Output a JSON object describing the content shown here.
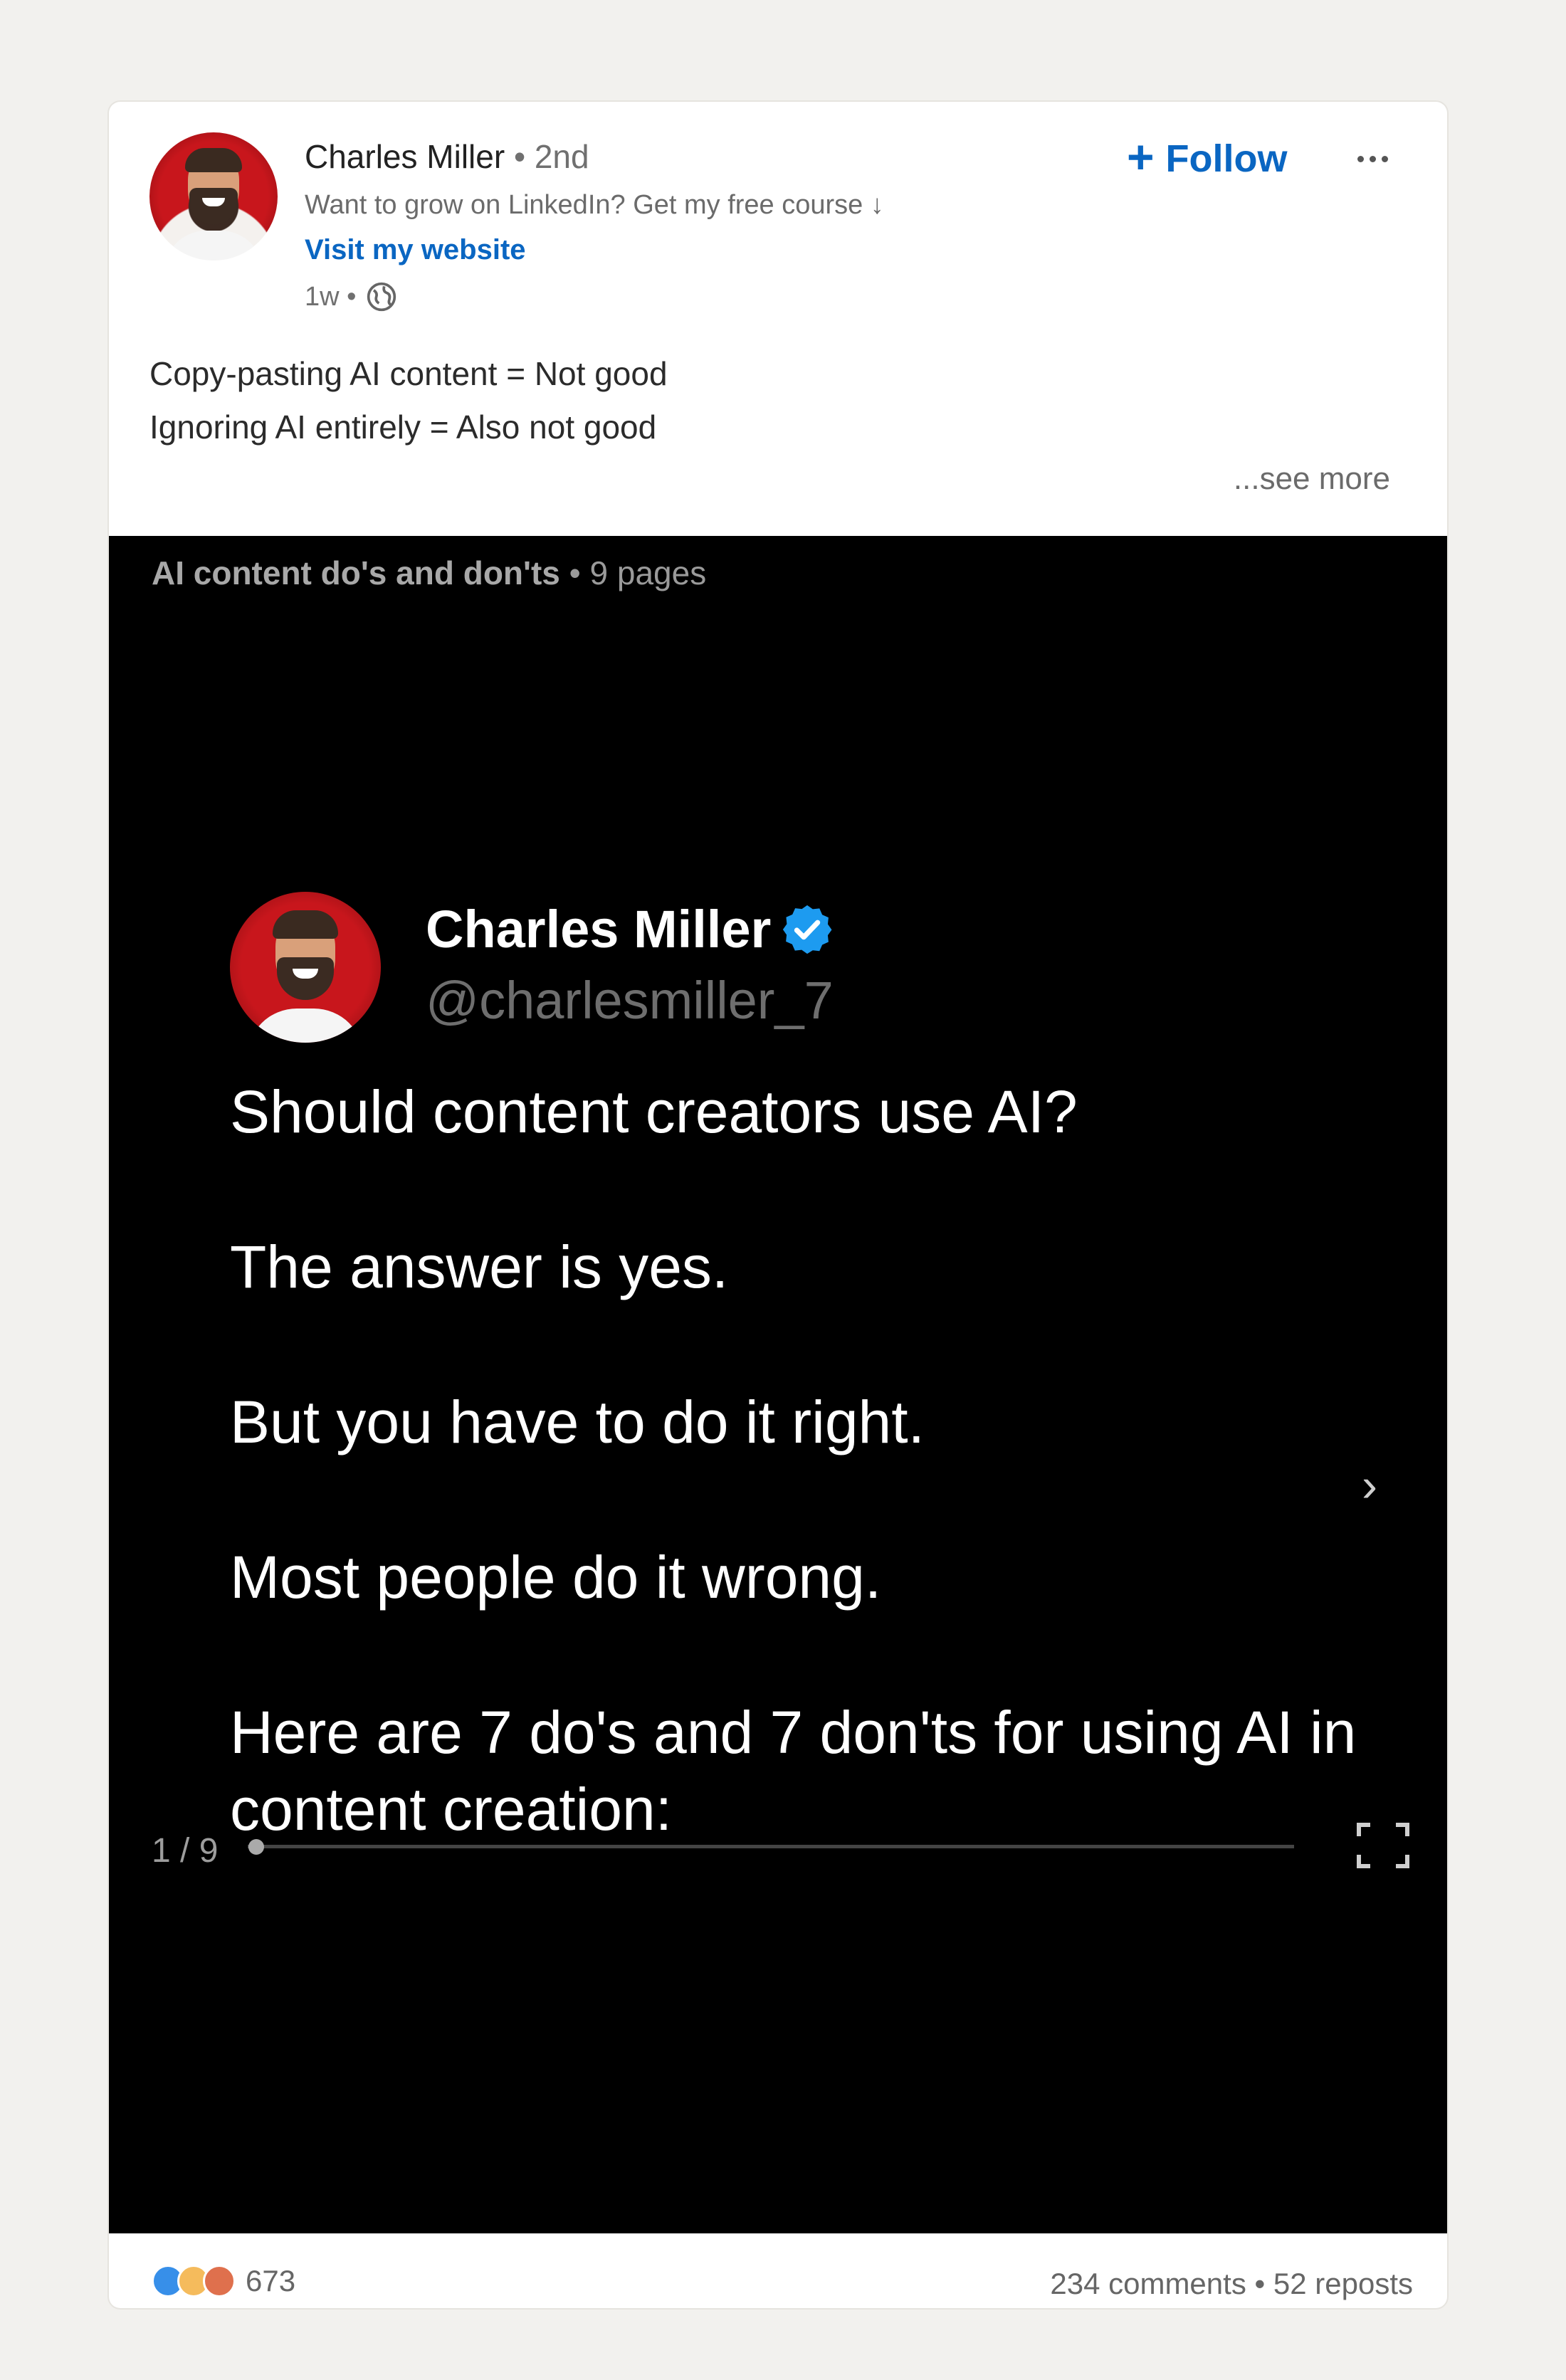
{
  "author": {
    "name": "Charles Miller",
    "degree": "• 2nd",
    "tagline": "Want to grow on LinkedIn? Get my free course ↓",
    "website_link": "Visit my website",
    "posted": "1w •"
  },
  "actions": {
    "follow_label": "Follow",
    "follow_plus": "+"
  },
  "post": {
    "line1": "Copy-pasting AI content = Not good",
    "line2": "Ignoring AI entirely = Also not good",
    "see_more": "...see more"
  },
  "document": {
    "title": "AI content do's and don'ts",
    "pages": "• 9 pages",
    "slide": {
      "name": "Charles Miller",
      "handle": "@charlesmiller_7",
      "paragraphs": [
        "Should content creators use AI?",
        "The answer is yes.",
        "But you have to do it right.",
        "Most people do it wrong.",
        "Here are 7 do's and 7 don'ts for using AI in content creation:"
      ]
    },
    "next_arrow": "›",
    "page_indicator": "1 / 9",
    "progress": 0.0
  },
  "social": {
    "reaction_count": "673",
    "comments": "234 comments",
    "separator": " • ",
    "reposts": "52 reposts",
    "reaction_icons": [
      "like-icon",
      "insightful-icon",
      "love-icon"
    ]
  },
  "colors": {
    "brand_blue": "#0a66c2",
    "verified_blue": "#1d9bf0",
    "background": "#f2f1ee"
  }
}
